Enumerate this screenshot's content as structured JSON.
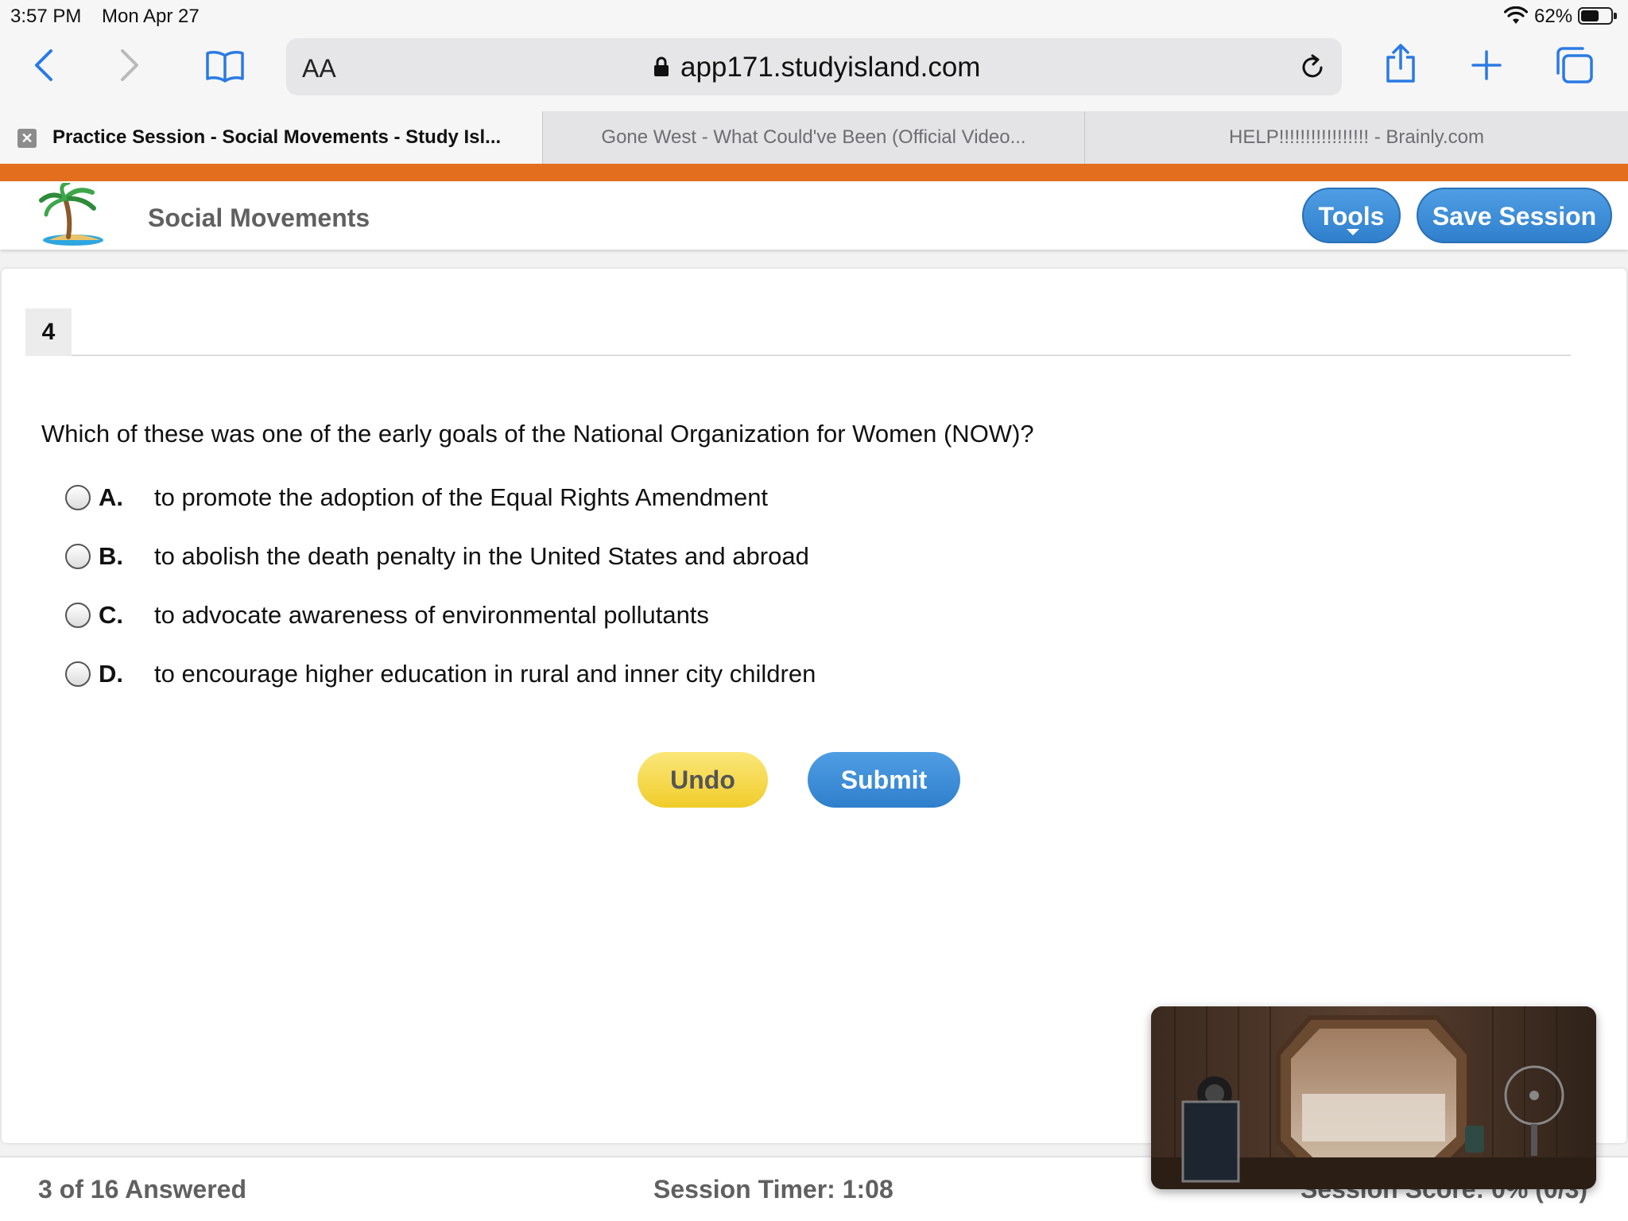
{
  "status_bar": {
    "time": "3:57 PM",
    "date": "Mon Apr 27",
    "battery_percent": "62%",
    "battery_level": 0.62,
    "icons": [
      "wifi-icon",
      "battery-icon"
    ]
  },
  "browser": {
    "text_size_label": "AA",
    "url": "app171.studyisland.com",
    "icons": [
      "back-icon",
      "forward-icon",
      "bookmarks-icon",
      "lock-icon",
      "reload-icon",
      "share-icon",
      "new-tab-icon",
      "tabs-icon"
    ],
    "tabs": [
      {
        "title": "Practice Session - Social Movements - Study Isl...",
        "active": true
      },
      {
        "title": "Gone West - What Could've Been (Official Video...",
        "active": false
      },
      {
        "title": "HELP!!!!!!!!!!!!!!!!! - Brainly.com",
        "active": false
      }
    ]
  },
  "colors": {
    "accent_orange": "#e36f1e",
    "button_blue": "#2f7fcc",
    "button_yellow": "#f0cc2a"
  },
  "app": {
    "title": "Social Movements",
    "tools_label": "Tools",
    "save_label": "Save Session"
  },
  "question": {
    "number": "4",
    "text": "Which of these was one of the early goals of the National Organization for Women (NOW)?",
    "choices": [
      {
        "letter": "A.",
        "text": "to promote the adoption of the Equal Rights Amendment"
      },
      {
        "letter": "B.",
        "text": "to abolish the death penalty in the United States and abroad"
      },
      {
        "letter": "C.",
        "text": "to advocate awareness of environmental pollutants"
      },
      {
        "letter": "D.",
        "text": "to encourage higher education in rural and inner city children"
      }
    ],
    "undo_label": "Undo",
    "submit_label": "Submit"
  },
  "footer": {
    "answered": "3 of 16 Answered",
    "timer": "Session Timer: 1:08",
    "score": "Session Score: 0% (0/3)"
  }
}
